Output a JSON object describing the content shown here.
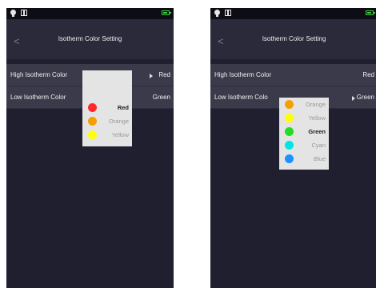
{
  "left": {
    "title": "Isotherm Color Setting",
    "high_label": "High Isotherm Color",
    "high_value": "Red",
    "low_label": "Low Isotherm Color",
    "low_value": "Green",
    "options": [
      {
        "label": "Red",
        "color": "#ff2b2b",
        "selected": true
      },
      {
        "label": "Orange",
        "color": "#f5a000",
        "selected": false
      },
      {
        "label": "Yellow",
        "color": "#ffff00",
        "selected": false
      }
    ]
  },
  "right": {
    "title": "Isotherm Color Setting",
    "high_label": "High Isotherm Color",
    "high_value": "Red",
    "low_label": "Low Isotherm Colo",
    "low_value": "Green",
    "options": [
      {
        "label": "Orange",
        "color": "#f5a000",
        "selected": false
      },
      {
        "label": "Yellow",
        "color": "#ffff00",
        "selected": false
      },
      {
        "label": "Green",
        "color": "#22dd22",
        "selected": true
      },
      {
        "label": "Cyan",
        "color": "#00e5e5",
        "selected": false
      },
      {
        "label": "Blue",
        "color": "#1e90ff",
        "selected": false
      }
    ]
  }
}
